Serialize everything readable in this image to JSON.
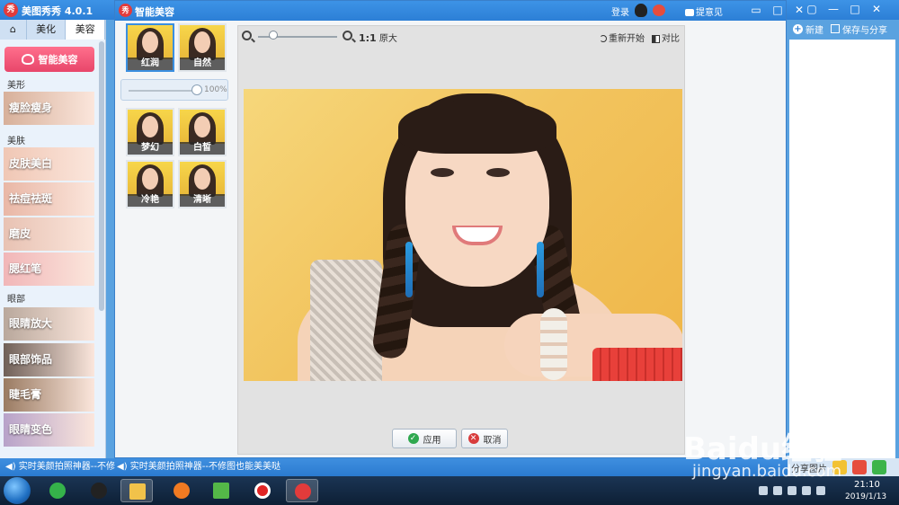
{
  "main_window": {
    "title": "美图秀秀 4.0.1",
    "logo_text": "秀",
    "controls": [
      "▢",
      "—",
      "□",
      "✕"
    ],
    "tabs": {
      "home": "⌂",
      "beautify": "美化",
      "beauty": "美容"
    },
    "smart_beauty_button": "智能美容",
    "sections": {
      "shape": "美形",
      "skin": "美肤",
      "eyes": "眼部"
    },
    "features": [
      {
        "label": "瘦脸瘦身",
        "color": "#d7b09a"
      },
      {
        "label": "皮肤美白",
        "color": "#f0c7b5"
      },
      {
        "label": "祛痘祛斑",
        "color": "#e9b7a6"
      },
      {
        "label": "磨皮",
        "color": "#e8c2b3"
      },
      {
        "label": "腮红笔",
        "color": "#f1b6b8"
      },
      {
        "label": "眼睛放大",
        "color": "#b9a89c"
      },
      {
        "label": "眼部饰品",
        "color": "#6f6058"
      },
      {
        "label": "睫毛膏",
        "color": "#9a7b62"
      },
      {
        "label": "眼睛变色",
        "color": "#b7a2c9"
      }
    ],
    "toolbar": {
      "new": "新建",
      "save_share": "保存与分享"
    },
    "share_label": "分享图片"
  },
  "dialog": {
    "title": "智能美容",
    "logo_text": "秀",
    "login": "登录",
    "feedback": "提意见",
    "controls": [
      "▭",
      "□",
      "✕"
    ],
    "effects": [
      {
        "label": "红润",
        "selected": true
      },
      {
        "label": "自然",
        "selected": false
      },
      {
        "label": "梦幻",
        "selected": false
      },
      {
        "label": "白皙",
        "selected": false
      },
      {
        "label": "冷艳",
        "selected": false
      },
      {
        "label": "清晰",
        "selected": false
      }
    ],
    "intensity": {
      "value": "100%",
      "fraction": 1.0
    },
    "zoom": {
      "actual_prefix": "1:1",
      "actual_label": "原大"
    },
    "restart": "重新开始",
    "compare": "对比",
    "apply": "应用",
    "cancel": "取消"
  },
  "status": {
    "ticker_1": "实时美颜拍照神器--不修图",
    "ticker_2": "实时美颜拍照神器--不修图也能美美哒"
  },
  "taskbar": {
    "time": "21:10",
    "date": "2019/1/13"
  },
  "watermark": {
    "line1": "Baidu经验",
    "line2": "jingyan.baidu.com"
  },
  "colors": {
    "accent": "#2c7fd6",
    "smart_button": "#e8466a",
    "apply_icon": "#2fa84f",
    "cancel_icon": "#d83c3c"
  }
}
